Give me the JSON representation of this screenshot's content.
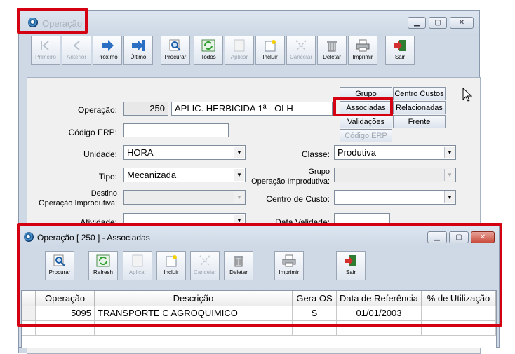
{
  "main_window": {
    "title": "Operação",
    "toolbar": [
      {
        "label": "Primeiro",
        "icon": "first-record-icon",
        "enabled": false
      },
      {
        "label": "Anterior",
        "icon": "previous-record-icon",
        "enabled": false
      },
      {
        "label": "Próximo",
        "icon": "next-record-icon",
        "enabled": true
      },
      {
        "label": "Último",
        "icon": "last-record-icon",
        "enabled": true
      },
      {
        "label": "Procurar",
        "icon": "search-icon",
        "enabled": true
      },
      {
        "label": "Todos",
        "icon": "refresh-all-icon",
        "enabled": true
      },
      {
        "label": "Aplicar",
        "icon": "apply-icon",
        "enabled": false
      },
      {
        "label": "Incluir",
        "icon": "new-record-icon",
        "enabled": true
      },
      {
        "label": "Cancelar",
        "icon": "cancel-icon",
        "enabled": false
      },
      {
        "label": "Deletar",
        "icon": "trash-icon",
        "enabled": true
      },
      {
        "label": "Imprimir",
        "icon": "printer-icon",
        "enabled": true
      },
      {
        "label": "Sair",
        "icon": "exit-door-icon",
        "enabled": true
      }
    ],
    "form": {
      "operacao_label": "Operação:",
      "operacao_code": "250",
      "operacao_desc": "APLIC. HERBICIDA 1ª - OLH",
      "codigo_erp_label": "Código ERP:",
      "codigo_erp_value": "",
      "unidade_label": "Unidade:",
      "unidade_value": "HORA",
      "tipo_label": "Tipo:",
      "tipo_value": "Mecanizada",
      "destino_label_1": "Destino",
      "destino_label_2": "Operação Improdutiva:",
      "destino_value": "",
      "atividade_label": "Atividade:",
      "classe_label": "Classe:",
      "classe_value": "Produtiva",
      "grupo_improd_label_1": "Grupo",
      "grupo_improd_label_2": "Operação Improdutiva:",
      "grupo_improd_value": "",
      "centro_custo_label": "Centro de Custo:",
      "centro_custo_value": "",
      "data_validade_label": "Data Validade:"
    },
    "side_buttons": {
      "grupo": "Grupo",
      "centro_custos": "Centro Custos",
      "associadas": "Associadas",
      "relacionadas": "Relacionadas",
      "validacoes": "Validações",
      "frente": "Frente",
      "codigo_erp": "Código ERP"
    }
  },
  "child_window": {
    "title": "Operação [ 250 ] - Associadas",
    "toolbar": [
      {
        "label": "Procurar",
        "icon": "search-icon",
        "enabled": true
      },
      {
        "label": "Refresh",
        "icon": "refresh-icon",
        "enabled": true
      },
      {
        "label": "Aplicar",
        "icon": "apply-icon",
        "enabled": false
      },
      {
        "label": "Incluir",
        "icon": "new-record-icon",
        "enabled": true
      },
      {
        "label": "Cancelar",
        "icon": "cancel-icon",
        "enabled": false
      },
      {
        "label": "Deletar",
        "icon": "trash-icon",
        "enabled": true
      },
      {
        "label": "Imprimir",
        "icon": "printer-icon",
        "enabled": true
      },
      {
        "label": "Sair",
        "icon": "exit-door-icon",
        "enabled": true
      }
    ],
    "grid": {
      "columns": [
        "Operação",
        "Descrição",
        "Gera OS",
        "Data de Referência",
        "% de Utilização"
      ],
      "rows": [
        [
          "5095",
          "TRANSPORTE C AGROQUIMICO",
          "S",
          "01/01/2003",
          ""
        ]
      ]
    }
  },
  "colors": {
    "highlight": "#d40012",
    "window_bg": "#cfd9e6",
    "panel_bg": "#f0f0f0"
  }
}
